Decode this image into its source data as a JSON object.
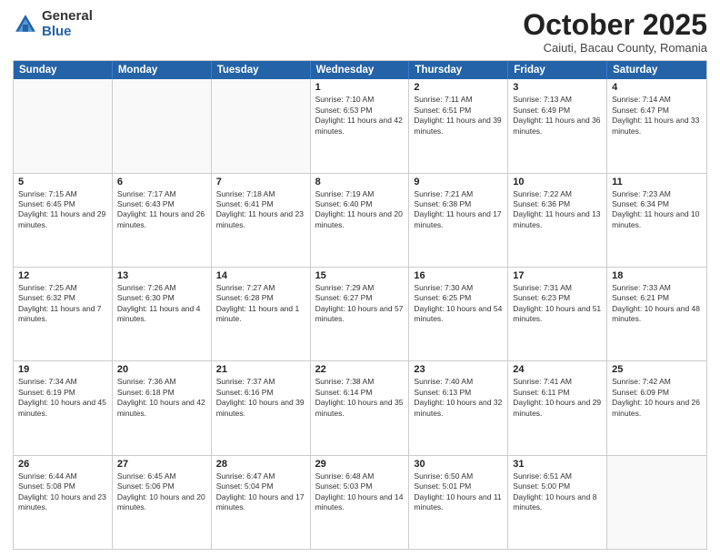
{
  "logo": {
    "general": "General",
    "blue": "Blue"
  },
  "title": {
    "month": "October 2025",
    "location": "Caiuti, Bacau County, Romania"
  },
  "days": [
    "Sunday",
    "Monday",
    "Tuesday",
    "Wednesday",
    "Thursday",
    "Friday",
    "Saturday"
  ],
  "weeks": [
    [
      {
        "day": "",
        "info": ""
      },
      {
        "day": "",
        "info": ""
      },
      {
        "day": "",
        "info": ""
      },
      {
        "day": "1",
        "info": "Sunrise: 7:10 AM\nSunset: 6:53 PM\nDaylight: 11 hours and 42 minutes."
      },
      {
        "day": "2",
        "info": "Sunrise: 7:11 AM\nSunset: 6:51 PM\nDaylight: 11 hours and 39 minutes."
      },
      {
        "day": "3",
        "info": "Sunrise: 7:13 AM\nSunset: 6:49 PM\nDaylight: 11 hours and 36 minutes."
      },
      {
        "day": "4",
        "info": "Sunrise: 7:14 AM\nSunset: 6:47 PM\nDaylight: 11 hours and 33 minutes."
      }
    ],
    [
      {
        "day": "5",
        "info": "Sunrise: 7:15 AM\nSunset: 6:45 PM\nDaylight: 11 hours and 29 minutes."
      },
      {
        "day": "6",
        "info": "Sunrise: 7:17 AM\nSunset: 6:43 PM\nDaylight: 11 hours and 26 minutes."
      },
      {
        "day": "7",
        "info": "Sunrise: 7:18 AM\nSunset: 6:41 PM\nDaylight: 11 hours and 23 minutes."
      },
      {
        "day": "8",
        "info": "Sunrise: 7:19 AM\nSunset: 6:40 PM\nDaylight: 11 hours and 20 minutes."
      },
      {
        "day": "9",
        "info": "Sunrise: 7:21 AM\nSunset: 6:38 PM\nDaylight: 11 hours and 17 minutes."
      },
      {
        "day": "10",
        "info": "Sunrise: 7:22 AM\nSunset: 6:36 PM\nDaylight: 11 hours and 13 minutes."
      },
      {
        "day": "11",
        "info": "Sunrise: 7:23 AM\nSunset: 6:34 PM\nDaylight: 11 hours and 10 minutes."
      }
    ],
    [
      {
        "day": "12",
        "info": "Sunrise: 7:25 AM\nSunset: 6:32 PM\nDaylight: 11 hours and 7 minutes."
      },
      {
        "day": "13",
        "info": "Sunrise: 7:26 AM\nSunset: 6:30 PM\nDaylight: 11 hours and 4 minutes."
      },
      {
        "day": "14",
        "info": "Sunrise: 7:27 AM\nSunset: 6:28 PM\nDaylight: 11 hours and 1 minute."
      },
      {
        "day": "15",
        "info": "Sunrise: 7:29 AM\nSunset: 6:27 PM\nDaylight: 10 hours and 57 minutes."
      },
      {
        "day": "16",
        "info": "Sunrise: 7:30 AM\nSunset: 6:25 PM\nDaylight: 10 hours and 54 minutes."
      },
      {
        "day": "17",
        "info": "Sunrise: 7:31 AM\nSunset: 6:23 PM\nDaylight: 10 hours and 51 minutes."
      },
      {
        "day": "18",
        "info": "Sunrise: 7:33 AM\nSunset: 6:21 PM\nDaylight: 10 hours and 48 minutes."
      }
    ],
    [
      {
        "day": "19",
        "info": "Sunrise: 7:34 AM\nSunset: 6:19 PM\nDaylight: 10 hours and 45 minutes."
      },
      {
        "day": "20",
        "info": "Sunrise: 7:36 AM\nSunset: 6:18 PM\nDaylight: 10 hours and 42 minutes."
      },
      {
        "day": "21",
        "info": "Sunrise: 7:37 AM\nSunset: 6:16 PM\nDaylight: 10 hours and 39 minutes."
      },
      {
        "day": "22",
        "info": "Sunrise: 7:38 AM\nSunset: 6:14 PM\nDaylight: 10 hours and 35 minutes."
      },
      {
        "day": "23",
        "info": "Sunrise: 7:40 AM\nSunset: 6:13 PM\nDaylight: 10 hours and 32 minutes."
      },
      {
        "day": "24",
        "info": "Sunrise: 7:41 AM\nSunset: 6:11 PM\nDaylight: 10 hours and 29 minutes."
      },
      {
        "day": "25",
        "info": "Sunrise: 7:42 AM\nSunset: 6:09 PM\nDaylight: 10 hours and 26 minutes."
      }
    ],
    [
      {
        "day": "26",
        "info": "Sunrise: 6:44 AM\nSunset: 5:08 PM\nDaylight: 10 hours and 23 minutes."
      },
      {
        "day": "27",
        "info": "Sunrise: 6:45 AM\nSunset: 5:06 PM\nDaylight: 10 hours and 20 minutes."
      },
      {
        "day": "28",
        "info": "Sunrise: 6:47 AM\nSunset: 5:04 PM\nDaylight: 10 hours and 17 minutes."
      },
      {
        "day": "29",
        "info": "Sunrise: 6:48 AM\nSunset: 5:03 PM\nDaylight: 10 hours and 14 minutes."
      },
      {
        "day": "30",
        "info": "Sunrise: 6:50 AM\nSunset: 5:01 PM\nDaylight: 10 hours and 11 minutes."
      },
      {
        "day": "31",
        "info": "Sunrise: 6:51 AM\nSunset: 5:00 PM\nDaylight: 10 hours and 8 minutes."
      },
      {
        "day": "",
        "info": ""
      }
    ]
  ]
}
